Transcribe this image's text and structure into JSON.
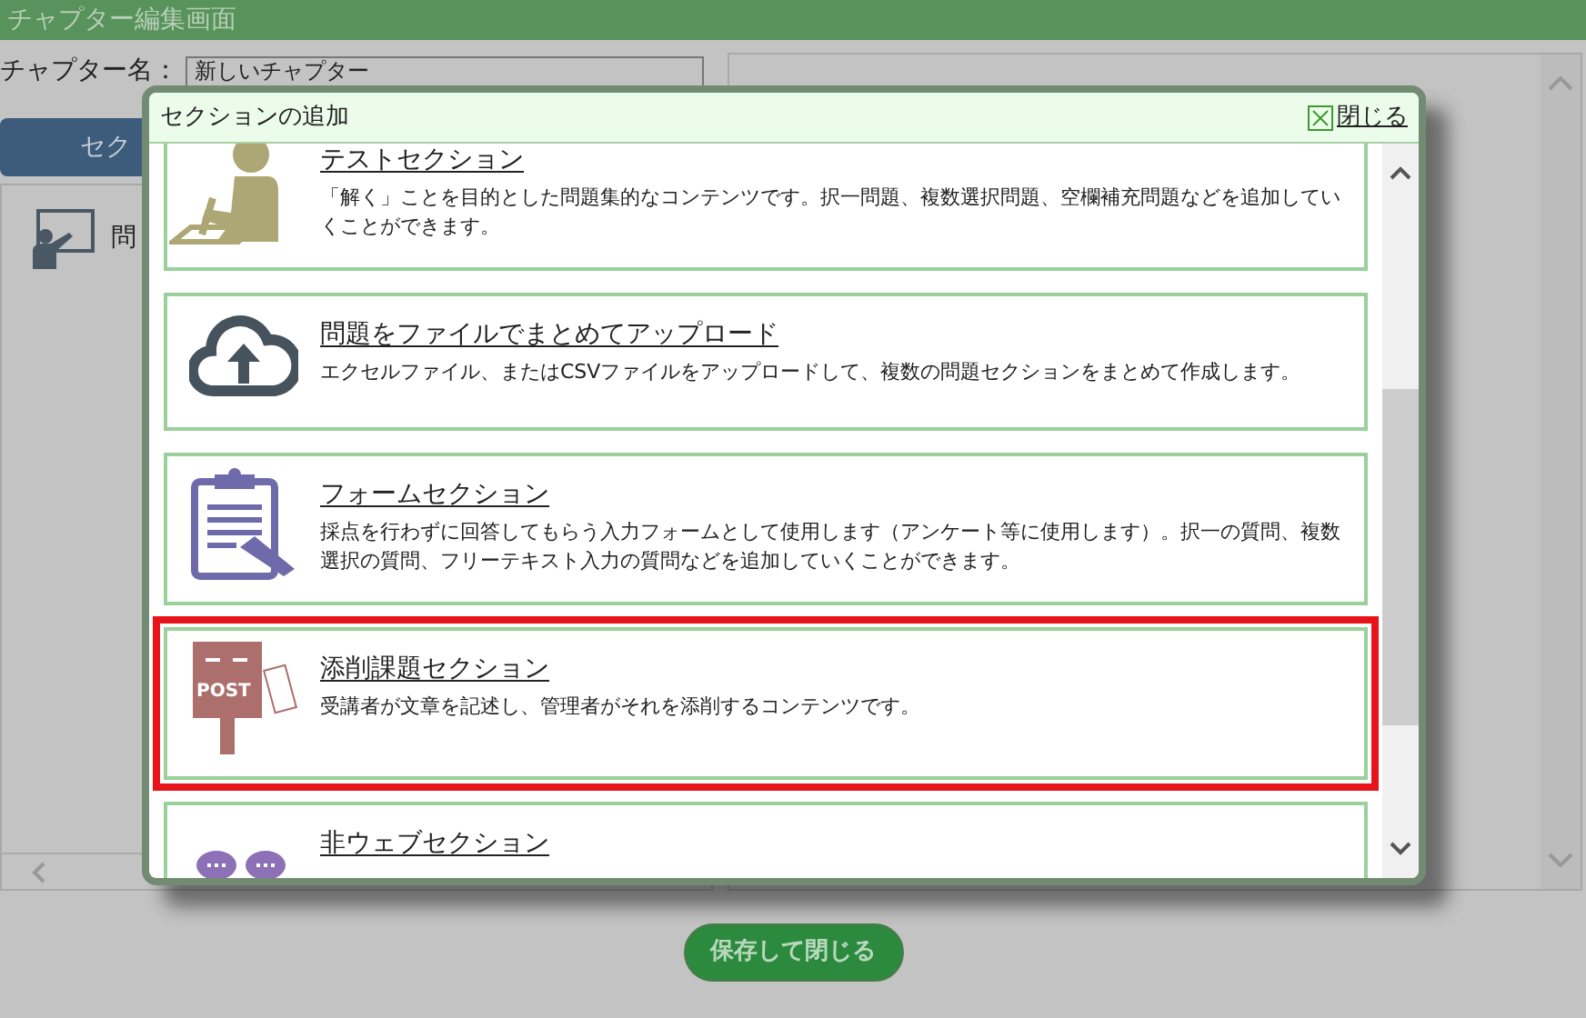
{
  "page": {
    "title": "チャプター編集画面",
    "name_label": "チャプター名：",
    "name_value": "新しいチャプター",
    "section_button": "セク",
    "list_items": [
      {
        "label": "問"
      }
    ],
    "save_button": "保存して閉じる"
  },
  "dialog": {
    "title": "セクションの追加",
    "close": "閉じる",
    "items": [
      {
        "kind": "test",
        "title": "テストセクション",
        "description": "「解く」ことを目的とした問題集的なコンテンツです。択一問題、複数選択問題、空欄補充問題などを追加していくことができます。",
        "highlighted": false
      },
      {
        "kind": "upload",
        "title": "問題をファイルでまとめてアップロード",
        "description": "エクセルファイル、またはCSVファイルをアップロードして、複数の問題セクションをまとめて作成します。",
        "highlighted": false
      },
      {
        "kind": "form",
        "title": "フォームセクション",
        "description": "採点を行わずに回答してもらう入力フォームとして使用します（アンケート等に使用します）。択一の質問、複数選択の質問、フリーテキスト入力の質問などを追加していくことができます。",
        "highlighted": false
      },
      {
        "kind": "post",
        "icon_text": "POST",
        "title": "添削課題セクション",
        "description": "受講者が文章を記述し、管理者がそれを添削するコンテンツです。",
        "highlighted": true
      },
      {
        "kind": "offline",
        "title": "非ウェブセクション",
        "highlighted": false
      }
    ]
  }
}
